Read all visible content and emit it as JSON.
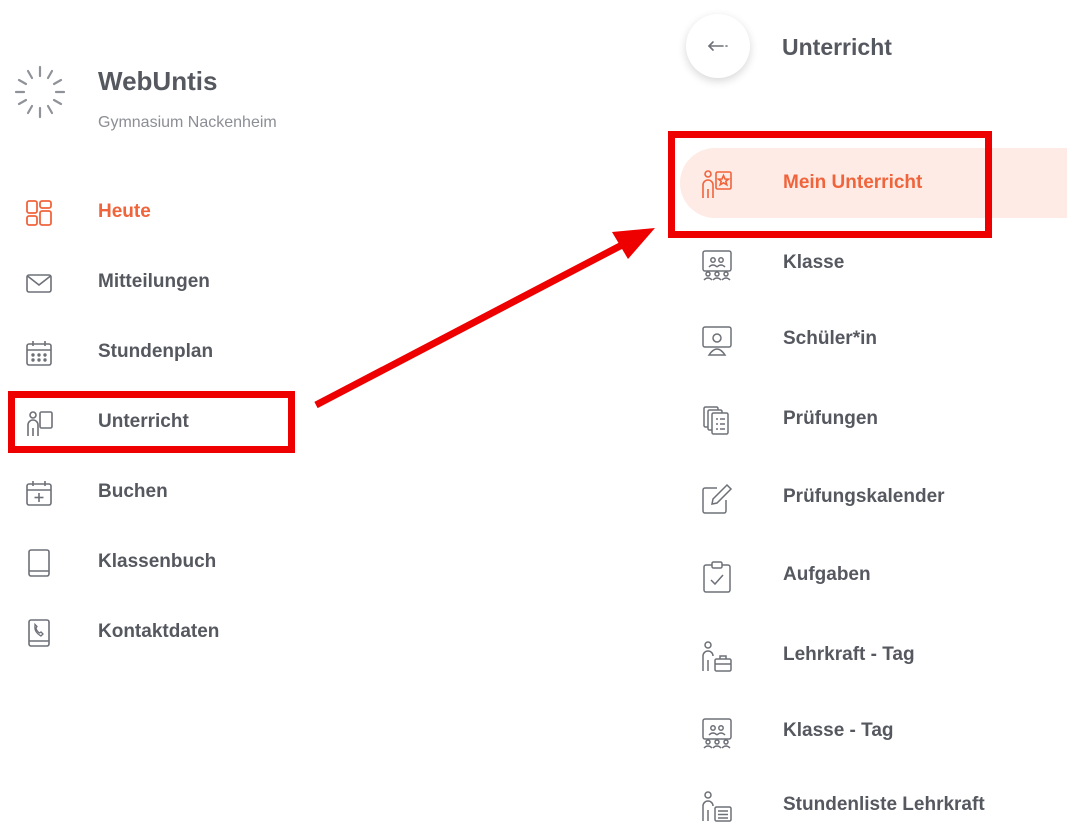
{
  "brand": {
    "name": "WebUntis",
    "school": "Gymnasium Nackenheim"
  },
  "nav": {
    "items": [
      {
        "label": "Heute",
        "icon": "dashboard-icon",
        "active": true
      },
      {
        "label": "Mitteilungen",
        "icon": "envelope-icon"
      },
      {
        "label": "Stundenplan",
        "icon": "calendar-icon"
      },
      {
        "label": "Unterricht",
        "icon": "teacher-board-icon"
      },
      {
        "label": "Buchen",
        "icon": "calendar-plus-icon"
      },
      {
        "label": "Klassenbuch",
        "icon": "book-icon"
      },
      {
        "label": "Kontaktdaten",
        "icon": "phone-book-icon"
      }
    ]
  },
  "panel": {
    "title": "Unterricht",
    "back_icon": "arrow-left-icon",
    "items": [
      {
        "label": "Mein Unterricht",
        "icon": "teacher-star-icon",
        "active": true
      },
      {
        "label": "Klasse",
        "icon": "class-group-icon"
      },
      {
        "label": "Schüler*in",
        "icon": "student-icon"
      },
      {
        "label": "Prüfungen",
        "icon": "exam-documents-icon"
      },
      {
        "label": "Prüfungskalender",
        "icon": "edit-pencil-icon"
      },
      {
        "label": "Aufgaben",
        "icon": "clipboard-check-icon"
      },
      {
        "label": "Lehrkraft - Tag",
        "icon": "teacher-briefcase-icon"
      },
      {
        "label": "Klasse - Tag",
        "icon": "class-group-icon"
      },
      {
        "label": "Stundenliste Lehrkraft",
        "icon": "teacher-list-icon"
      }
    ]
  },
  "colors": {
    "accent": "#f0643c",
    "active_bg": "#feebe5",
    "annotation": "#ee0000",
    "text": "#55585f",
    "muted": "#8b8e94"
  }
}
